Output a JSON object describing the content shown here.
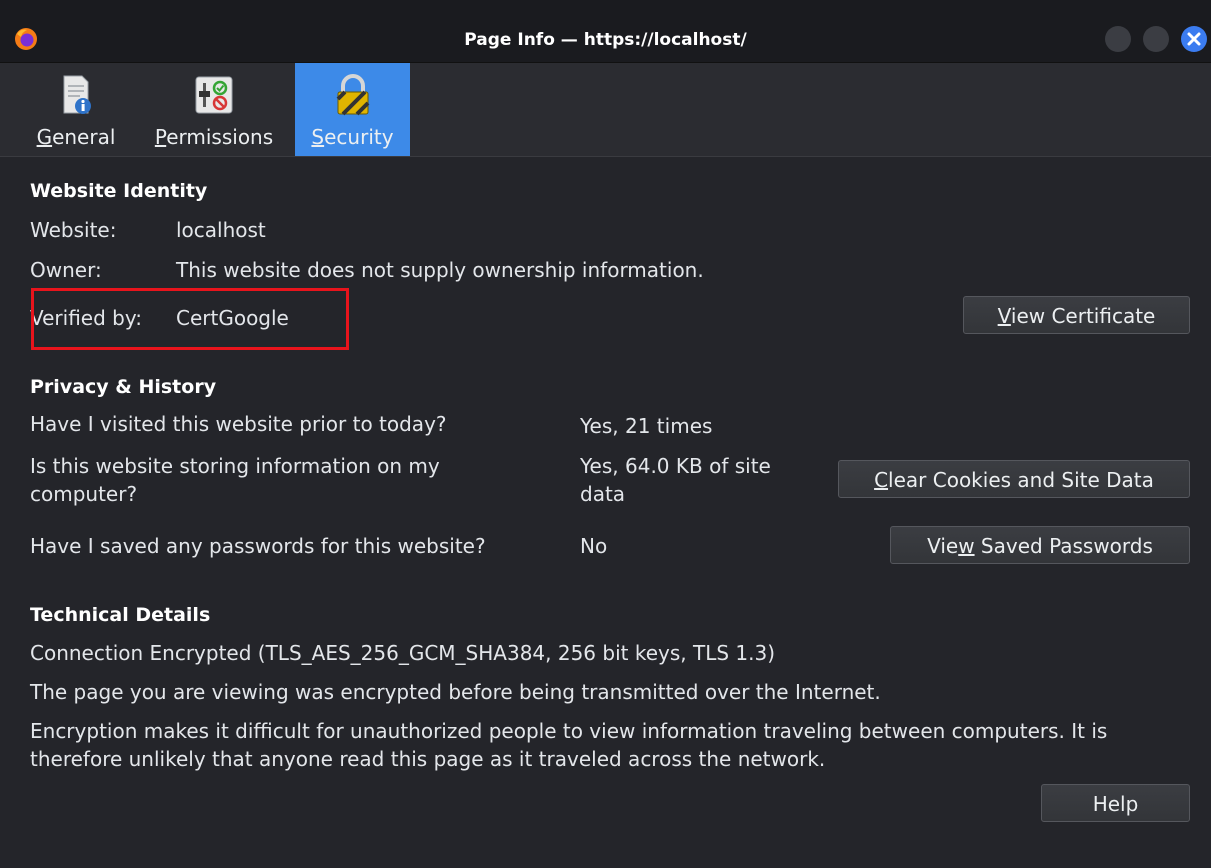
{
  "window": {
    "title": "Page Info — https://localhost/"
  },
  "tabs": [
    {
      "label_pre": "",
      "label_key": "G",
      "label_post": "eneral",
      "icon": "document-info-icon"
    },
    {
      "label_pre": "",
      "label_key": "P",
      "label_post": "ermissions",
      "icon": "permissions-toggle-icon"
    },
    {
      "label_pre": "",
      "label_key": "S",
      "label_post": "ecurity",
      "icon": "padlock-icon",
      "active": true
    }
  ],
  "identity": {
    "heading": "Website Identity",
    "website_label": "Website:",
    "website_value": "localhost",
    "owner_label": "Owner:",
    "owner_value": "This website does not supply ownership information.",
    "verified_label": "Verified by:",
    "verified_value": "CertGoogle",
    "view_cert_pre": "",
    "view_cert_key": "V",
    "view_cert_post": "iew Certificate"
  },
  "privacy": {
    "heading": "Privacy & History",
    "q1": "Have I visited this website prior to today?",
    "a1": "Yes, 21 times",
    "q2_line1": "Is this website storing information on my",
    "q2_line2": "computer?",
    "a2_line1": "Yes, 64.0 KB of site",
    "a2_line2": "data",
    "clear_pre": "",
    "clear_key": "C",
    "clear_post": "lear Cookies and Site Data",
    "q3": "Have I saved any passwords for this website?",
    "a3": "No",
    "saved_pre": "Vie",
    "saved_key": "w",
    "saved_post": " Saved Passwords"
  },
  "technical": {
    "heading": "Technical Details",
    "line1": "Connection Encrypted (TLS_AES_256_GCM_SHA384, 256 bit keys, TLS 1.3)",
    "line2": "The page you are viewing was encrypted before being transmitted over the Internet.",
    "line3a": "Encryption makes it difficult for unauthorized people to view information traveling between computers. It is",
    "line3b": "therefore unlikely that anyone read this page as it traveled across the network."
  },
  "footer": {
    "help_label": "Help"
  },
  "colors": {
    "accent": "#3d8ae8",
    "highlight_box": "#e8141c",
    "background": "#24252a"
  }
}
